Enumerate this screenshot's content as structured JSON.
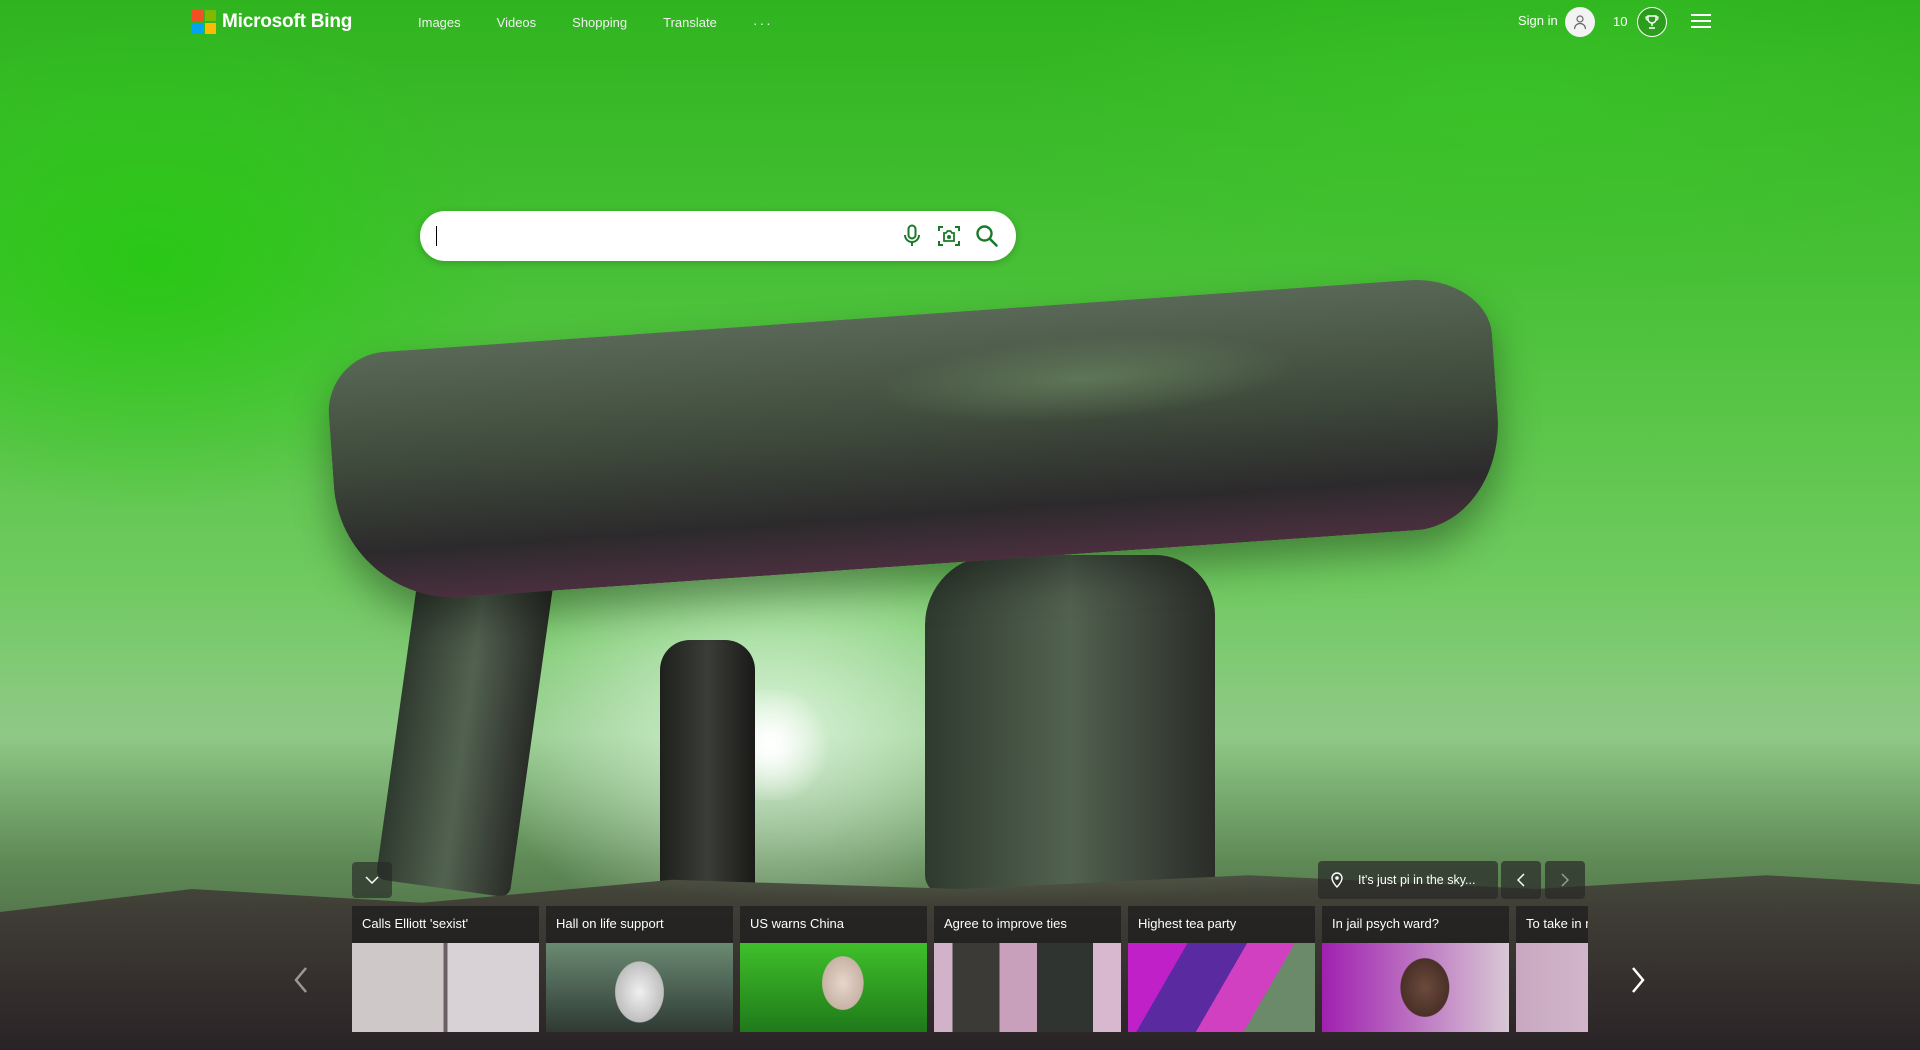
{
  "brand": {
    "name": "Microsoft Bing",
    "logo_colors": [
      "#f25022",
      "#7fba00",
      "#00a4ef",
      "#ffb900"
    ]
  },
  "nav": {
    "items": [
      "Images",
      "Videos",
      "Shopping",
      "Translate"
    ],
    "more": "···"
  },
  "account": {
    "signin_label": "Sign in",
    "points": "10"
  },
  "search": {
    "value": "",
    "placeholder": "",
    "icons": [
      "mic-icon",
      "visual-search-icon",
      "search-icon"
    ],
    "accent": "#1a7a2a"
  },
  "image_info": {
    "caption": "It's just pi in the sky..."
  },
  "news": {
    "cards": [
      {
        "title": "Calls Elliott 'sexist'"
      },
      {
        "title": "Hall on life support"
      },
      {
        "title": "US warns China"
      },
      {
        "title": "Agree to improve ties"
      },
      {
        "title": "Highest tea party"
      },
      {
        "title": "In jail psych ward?"
      },
      {
        "title": "To take in n"
      }
    ]
  }
}
